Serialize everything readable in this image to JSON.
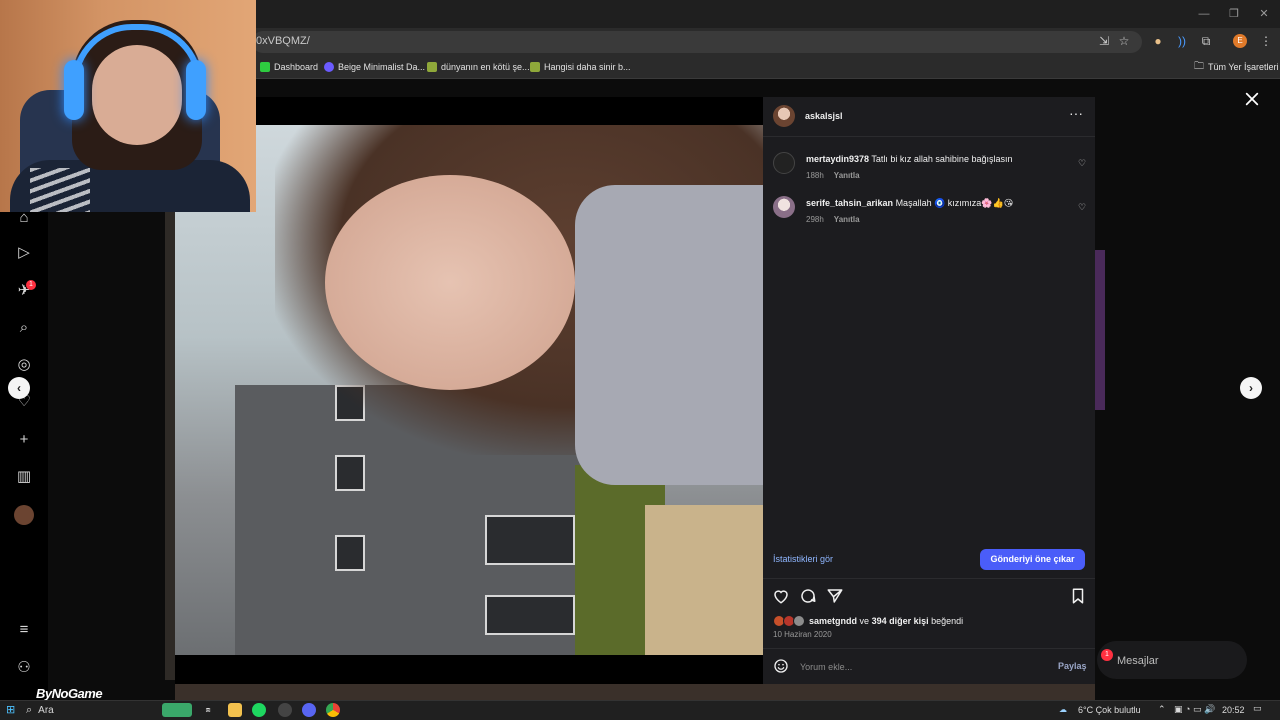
{
  "browser": {
    "url": "0xVBQMZ/",
    "window_controls": [
      "—",
      "❐",
      "✕"
    ],
    "profile_initial": "E",
    "bookmarks": [
      {
        "label": "Dashboard",
        "color": "#2ecc40"
      },
      {
        "label": "Beige Minimalist Da...",
        "color": "#6b5bff"
      },
      {
        "label": "dünyanın en kötü şe...",
        "color": "#8fa83a"
      },
      {
        "label": "Hangisi daha sinir b...",
        "color": "#8fa83a"
      }
    ],
    "all_bookmarks_label": "Tüm Yer İşaretleri"
  },
  "left_rail": {
    "notification_badge": "1",
    "icons": [
      "home-icon",
      "reels-icon",
      "messages-icon",
      "search-icon",
      "explore-icon",
      "notifications-icon",
      "create-icon",
      "insights-icon",
      "profile-icon",
      "menu-icon",
      "apps-icon"
    ]
  },
  "post": {
    "owner": "askalsjsl",
    "comments": [
      {
        "user": "mertaydin9378",
        "text": "Tatlı bi kız allah sahibine bağışlasın",
        "time": "188h",
        "reply": "Yanıtla",
        "avatar_color": "#222"
      },
      {
        "user": "serife_tahsin_arikan",
        "text": "Maşallah 🧿 kızımıza🌸👍😘",
        "time": "298h",
        "reply": "Yanıtla",
        "avatar_color": "#c9b7c9"
      }
    ],
    "insights_label": "İstatistikleri gör",
    "boost_label": "Gönderiyi öne çıkar",
    "liked_by_user": "sametgndd",
    "liked_by_connector": "ve",
    "liked_by_others": "394 diğer kişi",
    "liked_by_suffix": "beğendi",
    "date": "10 Haziran 2020",
    "comment_placeholder": "Yorum ekle...",
    "share_label": "Paylaş"
  },
  "messages_pill": {
    "label": "Mesajlar",
    "badge": "1"
  },
  "watermark": "ByNoGame",
  "taskbar": {
    "search_label": "Ara",
    "weather": "6°C  Çok bulutlu",
    "time": "20:52"
  }
}
